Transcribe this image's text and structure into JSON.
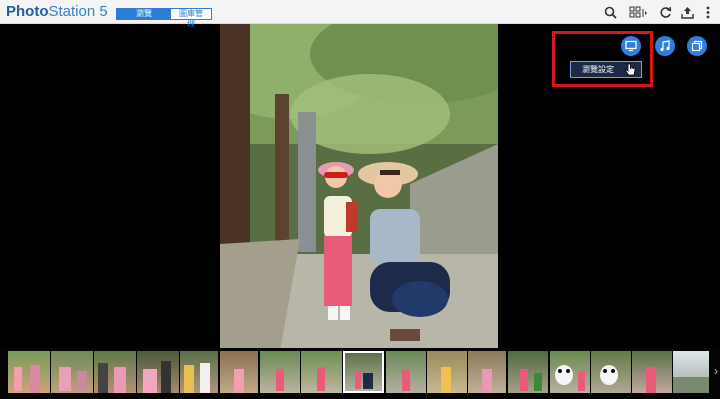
{
  "app": {
    "logo_part1": "Photo",
    "logo_part2": "Station",
    "logo_part3": " 5"
  },
  "modes": [
    {
      "label": "瀏覽",
      "active": true
    },
    {
      "label": "圖庫管理",
      "active": false
    }
  ],
  "toolbar": {
    "icons": [
      "search-icon",
      "grid-view-icon",
      "refresh-icon",
      "upload-icon",
      "more-icon"
    ]
  },
  "actions": {
    "icons": [
      "slideshow-icon",
      "music-icon",
      "copy-icon"
    ],
    "tooltip": "瀏覽設定"
  },
  "colors": {
    "accent": "#2f7fe0",
    "highlight": "#d11b1b",
    "topbar": "#f4f4f4"
  },
  "filmstrip": {
    "selected_index": 9,
    "count": 17
  }
}
